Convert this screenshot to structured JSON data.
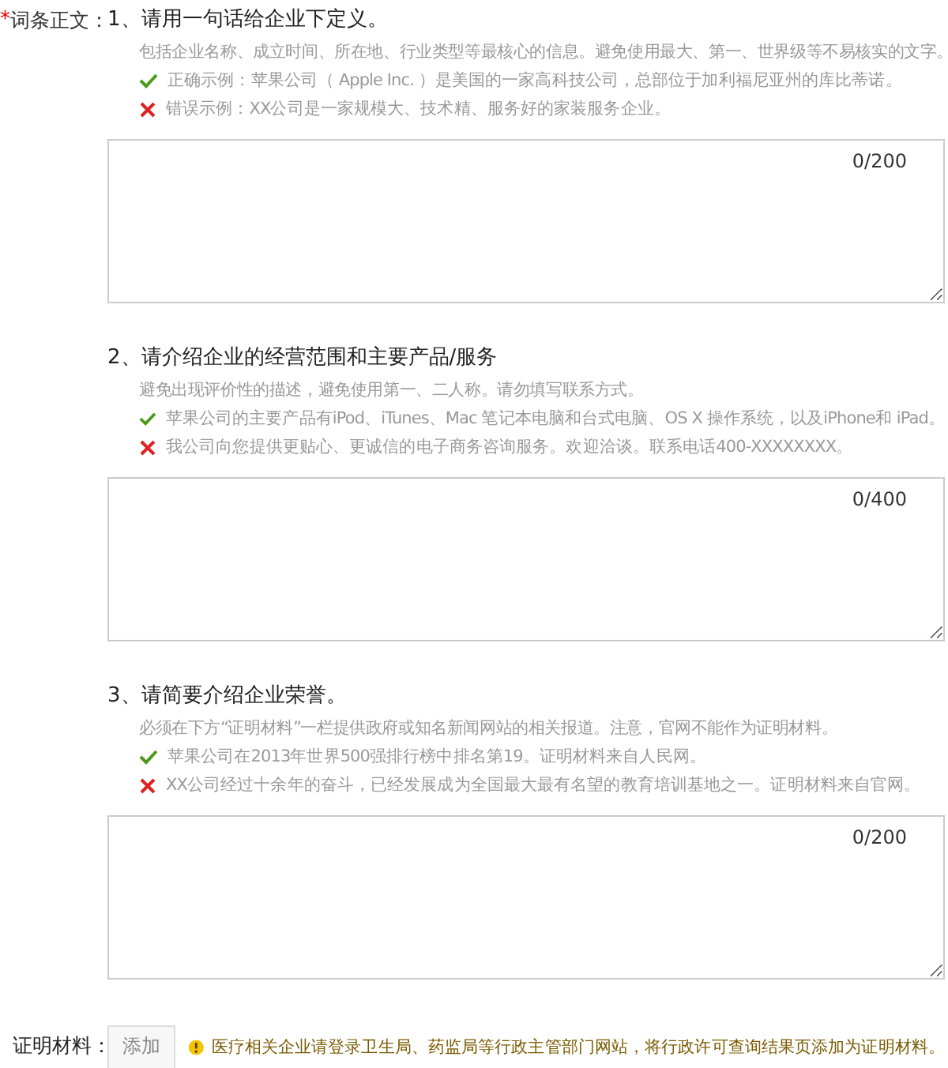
{
  "field": {
    "required_mark": "*",
    "label": "词条正文："
  },
  "sections": [
    {
      "number": "1、",
      "title": "请用一句话给企业下定义。",
      "hint": "包括企业名称、成立时间、所在地、行业类型等最核心的信息。避免使用最大、第一、世界级等不易核实的文字。",
      "examples": [
        {
          "kind": "correct",
          "text": "正确示例：苹果公司（ Apple Inc. ）是美国的一家高科技公司，总部位于加利福尼亚州的库比蒂诺。"
        },
        {
          "kind": "wrong",
          "text": "错误示例：XX公司是一家规模大、技术精、服务好的家装服务企业。"
        }
      ],
      "counter": "0/200"
    },
    {
      "number": "2、",
      "title": "请介绍企业的经营范围和主要产品/服务",
      "hint": "避免出现评价性的描述，避免使用第一、二人称。请勿填写联系方式。",
      "examples": [
        {
          "kind": "correct",
          "text": "苹果公司的主要产品有iPod、iTunes、Mac 笔记本电脑和台式电脑、OS X 操作系统，以及iPhone和 iPad。"
        },
        {
          "kind": "wrong",
          "text": "我公司向您提供更贴心、更诚信的电子商务咨询服务。欢迎洽谈。联系电话400-XXXXXXXX。"
        }
      ],
      "counter": "0/400"
    },
    {
      "number": "3、",
      "title": "请简要介绍企业荣誉。",
      "hint": "必须在下方“证明材料”一栏提供政府或知名新闻网站的相关报道。注意，官网不能作为证明材料。",
      "examples": [
        {
          "kind": "correct",
          "text": "苹果公司在2013年世界500强排行榜中排名第19。证明材料来自人民网。"
        },
        {
          "kind": "wrong",
          "text": "XX公司经过十余年的奋斗，已经发展成为全国最大最有名望的教育培训基地之一。证明材料来自官网。"
        }
      ],
      "counter": "0/200"
    }
  ],
  "evidence": {
    "label": "证明材料：",
    "button": "添加",
    "notice": "医疗相关企业请登录卫生局、药监局等行政主管部门网站，将行政许可查询结果页添加为证明材料。"
  }
}
